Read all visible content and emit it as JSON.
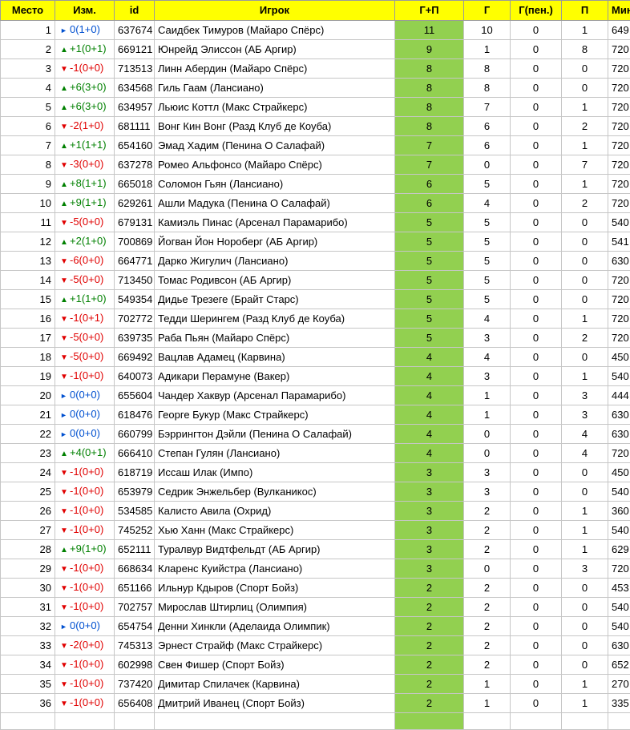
{
  "headers": {
    "place": "Место",
    "change": "Изм.",
    "id": "id",
    "player": "Игрок",
    "gp": "Г+П",
    "goals": "Г",
    "pen": "Г(пен.)",
    "assists": "П",
    "minutes": "Мин."
  },
  "rows": [
    {
      "place": "1",
      "dir": "same",
      "change": "0(1+0)",
      "id": "637674",
      "player": "Саидбек Тимуров (Майаро Спёрс)",
      "gp": "11",
      "g": "10",
      "pen": "0",
      "p": "1",
      "min": "649"
    },
    {
      "place": "2",
      "dir": "up",
      "change": "+1(0+1)",
      "id": "669121",
      "player": "Юнрейд Элиссон (АБ Аргир)",
      "gp": "9",
      "g": "1",
      "pen": "0",
      "p": "8",
      "min": "720"
    },
    {
      "place": "3",
      "dir": "down",
      "change": "-1(0+0)",
      "id": "713513",
      "player": "Линн Абердин (Майаро Спёрс)",
      "gp": "8",
      "g": "8",
      "pen": "0",
      "p": "0",
      "min": "720"
    },
    {
      "place": "4",
      "dir": "up",
      "change": "+6(3+0)",
      "id": "634568",
      "player": "Гиль Гаам (Лансиано)",
      "gp": "8",
      "g": "8",
      "pen": "0",
      "p": "0",
      "min": "720"
    },
    {
      "place": "5",
      "dir": "up",
      "change": "+6(3+0)",
      "id": "634957",
      "player": "Льюис Коттл (Макс Страйкерс)",
      "gp": "8",
      "g": "7",
      "pen": "0",
      "p": "1",
      "min": "720"
    },
    {
      "place": "6",
      "dir": "down",
      "change": "-2(1+0)",
      "id": "681111",
      "player": "Вонг Кин Вонг (Разд Клуб де Коуба)",
      "gp": "8",
      "g": "6",
      "pen": "0",
      "p": "2",
      "min": "720"
    },
    {
      "place": "7",
      "dir": "up",
      "change": "+1(1+1)",
      "id": "654160",
      "player": "Эмад Хадим (Пенина О Салафай)",
      "gp": "7",
      "g": "6",
      "pen": "0",
      "p": "1",
      "min": "720"
    },
    {
      "place": "8",
      "dir": "down",
      "change": "-3(0+0)",
      "id": "637278",
      "player": "Ромео Альфонсо (Майаро Спёрс)",
      "gp": "7",
      "g": "0",
      "pen": "0",
      "p": "7",
      "min": "720"
    },
    {
      "place": "9",
      "dir": "up",
      "change": "+8(1+1)",
      "id": "665018",
      "player": "Соломон Гьян (Лансиано)",
      "gp": "6",
      "g": "5",
      "pen": "0",
      "p": "1",
      "min": "720"
    },
    {
      "place": "10",
      "dir": "up",
      "change": "+9(1+1)",
      "id": "629261",
      "player": "Ашли Мадука (Пенина О Салафай)",
      "gp": "6",
      "g": "4",
      "pen": "0",
      "p": "2",
      "min": "720"
    },
    {
      "place": "11",
      "dir": "down",
      "change": "-5(0+0)",
      "id": "679131",
      "player": "Камиэль Пинас (Арсенал Парамарибо)",
      "gp": "5",
      "g": "5",
      "pen": "0",
      "p": "0",
      "min": "540"
    },
    {
      "place": "12",
      "dir": "up",
      "change": "+2(1+0)",
      "id": "700869",
      "player": "Йогван Йон Нороберг (АБ Аргир)",
      "gp": "5",
      "g": "5",
      "pen": "0",
      "p": "0",
      "min": "541"
    },
    {
      "place": "13",
      "dir": "down",
      "change": "-6(0+0)",
      "id": "664771",
      "player": "Дарко Жигулич (Лансиано)",
      "gp": "5",
      "g": "5",
      "pen": "0",
      "p": "0",
      "min": "630"
    },
    {
      "place": "14",
      "dir": "down",
      "change": "-5(0+0)",
      "id": "713450",
      "player": "Томас Родивсон (АБ Аргир)",
      "gp": "5",
      "g": "5",
      "pen": "0",
      "p": "0",
      "min": "720"
    },
    {
      "place": "15",
      "dir": "up",
      "change": "+1(1+0)",
      "id": "549354",
      "player": "Дидье Трезеге (Брайт Старс)",
      "gp": "5",
      "g": "5",
      "pen": "0",
      "p": "0",
      "min": "720"
    },
    {
      "place": "16",
      "dir": "down",
      "change": "-1(0+1)",
      "id": "702772",
      "player": "Тедди Шерингем (Разд Клуб де Коуба)",
      "gp": "5",
      "g": "4",
      "pen": "0",
      "p": "1",
      "min": "720"
    },
    {
      "place": "17",
      "dir": "down",
      "change": "-5(0+0)",
      "id": "639735",
      "player": "Раба Пьян (Майаро Спёрс)",
      "gp": "5",
      "g": "3",
      "pen": "0",
      "p": "2",
      "min": "720"
    },
    {
      "place": "18",
      "dir": "down",
      "change": "-5(0+0)",
      "id": "669492",
      "player": "Вацлав Адамец (Карвина)",
      "gp": "4",
      "g": "4",
      "pen": "0",
      "p": "0",
      "min": "450"
    },
    {
      "place": "19",
      "dir": "down",
      "change": "-1(0+0)",
      "id": "640073",
      "player": "Адикари Перамуне (Вакер)",
      "gp": "4",
      "g": "3",
      "pen": "0",
      "p": "1",
      "min": "540"
    },
    {
      "place": "20",
      "dir": "same",
      "change": "0(0+0)",
      "id": "655604",
      "player": "Чандер Хаквур (Арсенал Парамарибо)",
      "gp": "4",
      "g": "1",
      "pen": "0",
      "p": "3",
      "min": "444"
    },
    {
      "place": "21",
      "dir": "same",
      "change": "0(0+0)",
      "id": "618476",
      "player": "Георге Букур (Макс Страйкерс)",
      "gp": "4",
      "g": "1",
      "pen": "0",
      "p": "3",
      "min": "630"
    },
    {
      "place": "22",
      "dir": "same",
      "change": "0(0+0)",
      "id": "660799",
      "player": "Бэррингтон Дэйли (Пенина О Салафай)",
      "gp": "4",
      "g": "0",
      "pen": "0",
      "p": "4",
      "min": "630"
    },
    {
      "place": "23",
      "dir": "up",
      "change": "+4(0+1)",
      "id": "666410",
      "player": "Степан Гулян (Лансиано)",
      "gp": "4",
      "g": "0",
      "pen": "0",
      "p": "4",
      "min": "720"
    },
    {
      "place": "24",
      "dir": "down",
      "change": "-1(0+0)",
      "id": "618719",
      "player": "Иссаш Илак (Импо)",
      "gp": "3",
      "g": "3",
      "pen": "0",
      "p": "0",
      "min": "450"
    },
    {
      "place": "25",
      "dir": "down",
      "change": "-1(0+0)",
      "id": "653979",
      "player": "Седрик Энжельбер (Вулканикос)",
      "gp": "3",
      "g": "3",
      "pen": "0",
      "p": "0",
      "min": "540"
    },
    {
      "place": "26",
      "dir": "down",
      "change": "-1(0+0)",
      "id": "534585",
      "player": "Калисто Авила (Охрид)",
      "gp": "3",
      "g": "2",
      "pen": "0",
      "p": "1",
      "min": "360"
    },
    {
      "place": "27",
      "dir": "down",
      "change": "-1(0+0)",
      "id": "745252",
      "player": "Хью Ханн (Макс Страйкерс)",
      "gp": "3",
      "g": "2",
      "pen": "0",
      "p": "1",
      "min": "540"
    },
    {
      "place": "28",
      "dir": "up",
      "change": "+9(1+0)",
      "id": "652111",
      "player": "Туралвур Видтфельдт (АБ Аргир)",
      "gp": "3",
      "g": "2",
      "pen": "0",
      "p": "1",
      "min": "629"
    },
    {
      "place": "29",
      "dir": "down",
      "change": "-1(0+0)",
      "id": "668634",
      "player": "Кларенс Куийстра (Лансиано)",
      "gp": "3",
      "g": "0",
      "pen": "0",
      "p": "3",
      "min": "720"
    },
    {
      "place": "30",
      "dir": "down",
      "change": "-1(0+0)",
      "id": "651166",
      "player": "Ильнур Кдыров (Спорт Бойз)",
      "gp": "2",
      "g": "2",
      "pen": "0",
      "p": "0",
      "min": "453"
    },
    {
      "place": "31",
      "dir": "down",
      "change": "-1(0+0)",
      "id": "702757",
      "player": "Мирослав Штирлиц (Олимпия)",
      "gp": "2",
      "g": "2",
      "pen": "0",
      "p": "0",
      "min": "540"
    },
    {
      "place": "32",
      "dir": "same",
      "change": "0(0+0)",
      "id": "654754",
      "player": "Денни Хинкли (Аделаида Олимпик)",
      "gp": "2",
      "g": "2",
      "pen": "0",
      "p": "0",
      "min": "540"
    },
    {
      "place": "33",
      "dir": "down",
      "change": "-2(0+0)",
      "id": "745313",
      "player": "Эрнест Страйф (Макс Страйкерс)",
      "gp": "2",
      "g": "2",
      "pen": "0",
      "p": "0",
      "min": "630"
    },
    {
      "place": "34",
      "dir": "down",
      "change": "-1(0+0)",
      "id": "602998",
      "player": "Свен Фишер (Спорт Бойз)",
      "gp": "2",
      "g": "2",
      "pen": "0",
      "p": "0",
      "min": "652"
    },
    {
      "place": "35",
      "dir": "down",
      "change": "-1(0+0)",
      "id": "737420",
      "player": "Димитар Спилачек (Карвина)",
      "gp": "2",
      "g": "1",
      "pen": "0",
      "p": "1",
      "min": "270"
    },
    {
      "place": "36",
      "dir": "down",
      "change": "-1(0+0)",
      "id": "656408",
      "player": "Дмитрий Иванец (Спорт Бойз)",
      "gp": "2",
      "g": "1",
      "pen": "0",
      "p": "1",
      "min": "335"
    },
    {
      "place": "",
      "dir": "",
      "change": "",
      "id": "",
      "player": "",
      "gp": "",
      "g": "",
      "pen": "",
      "p": "",
      "min": ""
    }
  ],
  "icons": {
    "up": "triangle-up-icon",
    "down": "triangle-down-icon",
    "same": "triangle-right-icon"
  },
  "colors": {
    "header_bg": "#ffff00",
    "gp_bg": "#92d050",
    "up": "#008000",
    "down": "#e00000",
    "same": "#0050d0"
  }
}
